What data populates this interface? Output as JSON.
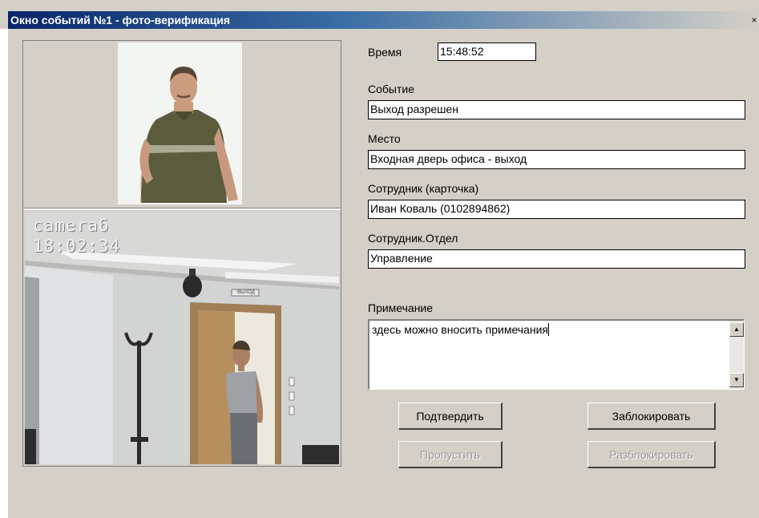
{
  "window": {
    "title": "Окно событий №1 - фото-верификация",
    "close_glyph": "×"
  },
  "camera": {
    "name": "camera6",
    "time": "18:02:34",
    "door_sign": "ВЫХОД"
  },
  "form": {
    "time_label": "Время",
    "time_value": "15:48:52",
    "event_label": "Событие",
    "event_value": "Выход разрешен",
    "place_label": "Место",
    "place_value": "Входная дверь офиса - выход",
    "employee_label": "Сотрудник (карточка)",
    "employee_value": "Иван Коваль (0102894862)",
    "department_label": "Сотрудник.Отдел",
    "department_value": "Управление",
    "note_label": "Примечание",
    "note_value": "здесь можно вносить примечания"
  },
  "buttons": {
    "confirm": "Подтвердить",
    "block": "Заблокировать",
    "skip": "Пропустить",
    "unblock": "Разблокировать"
  },
  "icons": {
    "scroll_up": "scroll-up-arrow-icon",
    "scroll_down": "scroll-down-arrow-icon",
    "close": "close-icon"
  }
}
